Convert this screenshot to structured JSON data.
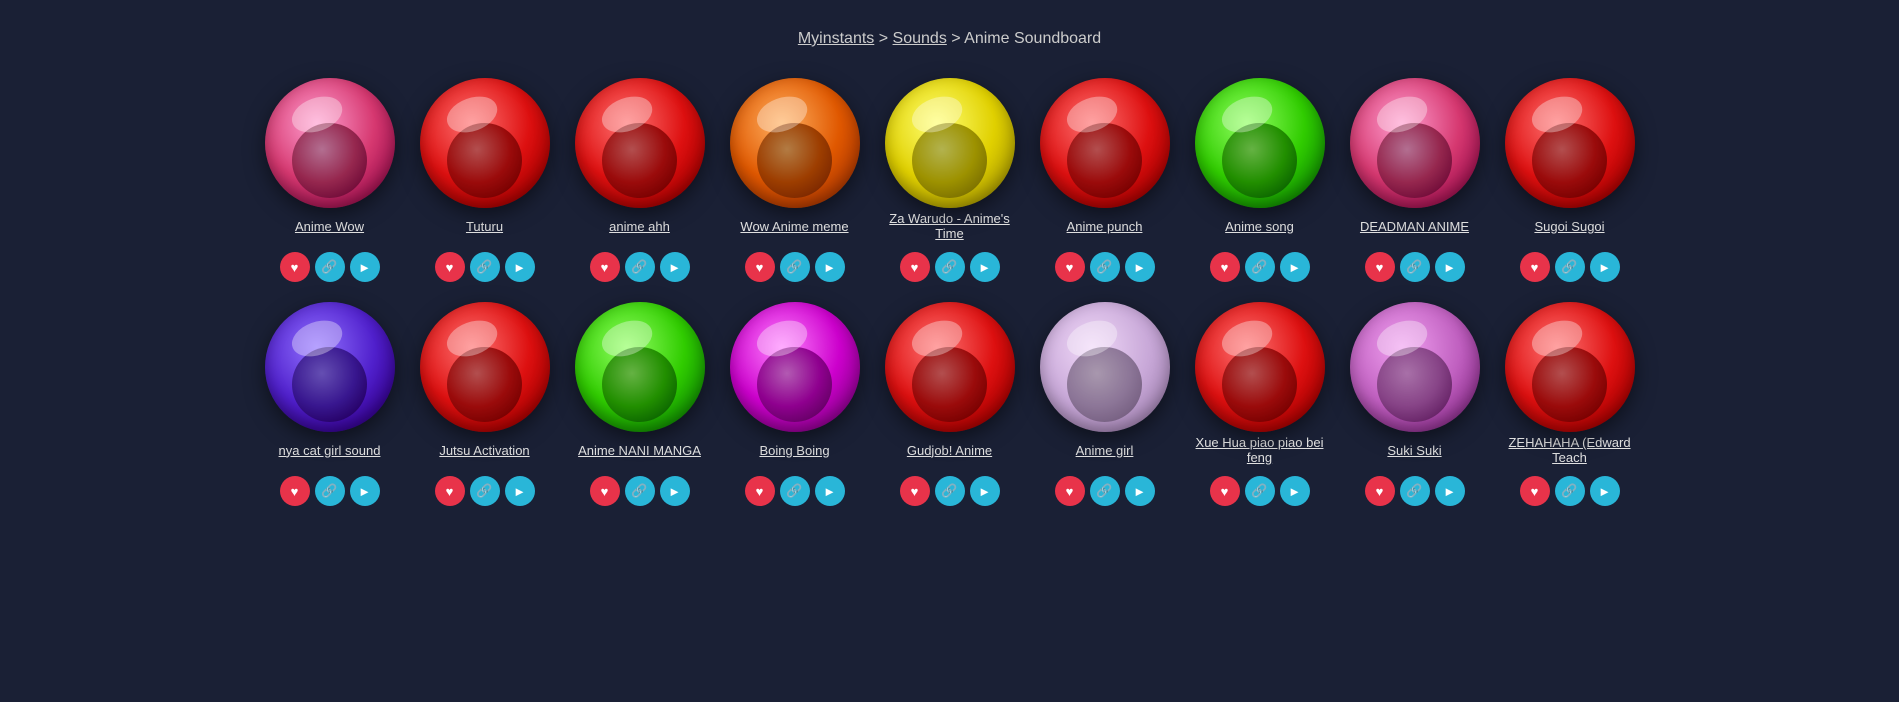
{
  "breadcrumb": {
    "site": "Myinstants",
    "separator1": ">",
    "sounds": "Sounds",
    "separator2": ">",
    "current": "Anime Soundboard"
  },
  "sounds_row1": [
    {
      "id": "anime-wow",
      "label": "Anime Wow",
      "color": "btn-pink"
    },
    {
      "id": "tuturu",
      "label": "Tuturu",
      "color": "btn-red"
    },
    {
      "id": "anime-ahh",
      "label": "anime ahh",
      "color": "btn-red"
    },
    {
      "id": "wow-anime-meme",
      "label": "Wow Anime meme",
      "color": "btn-orange"
    },
    {
      "id": "za-warudo",
      "label": "Za Warudo - Anime's Time",
      "color": "btn-yellow"
    },
    {
      "id": "anime-punch",
      "label": "Anime punch",
      "color": "btn-red"
    },
    {
      "id": "anime-song",
      "label": "Anime song",
      "color": "btn-green"
    },
    {
      "id": "deadman-anime",
      "label": "DEADMAN ANIME",
      "color": "btn-pink"
    },
    {
      "id": "sugoi-sugoi",
      "label": "Sugoi Sugoi",
      "color": "btn-red"
    }
  ],
  "sounds_row2": [
    {
      "id": "nya-cat-girl",
      "label": "nya cat girl sound",
      "color": "btn-purple"
    },
    {
      "id": "jutsu-activation",
      "label": "Jutsu Activation",
      "color": "btn-red"
    },
    {
      "id": "anime-nani-manga",
      "label": "Anime NANI MANGA",
      "color": "btn-green"
    },
    {
      "id": "boing-boing",
      "label": "Boing Boing",
      "color": "btn-magenta"
    },
    {
      "id": "gudjob-anime",
      "label": "Gudjob! Anime",
      "color": "btn-red"
    },
    {
      "id": "anime-girl",
      "label": "Anime girl",
      "color": "btn-lavender"
    },
    {
      "id": "xue-hua-piao",
      "label": "Xue Hua piao piao bei feng",
      "color": "btn-red"
    },
    {
      "id": "suki-suki",
      "label": "Suki Suki",
      "color": "btn-light-purple"
    },
    {
      "id": "zehahaha",
      "label": "ZEHAHAHA (Edward Teach",
      "color": "btn-red"
    }
  ],
  "actions": {
    "heart_icon": "♥",
    "link_icon": "🔗",
    "share_icon": "▶"
  }
}
